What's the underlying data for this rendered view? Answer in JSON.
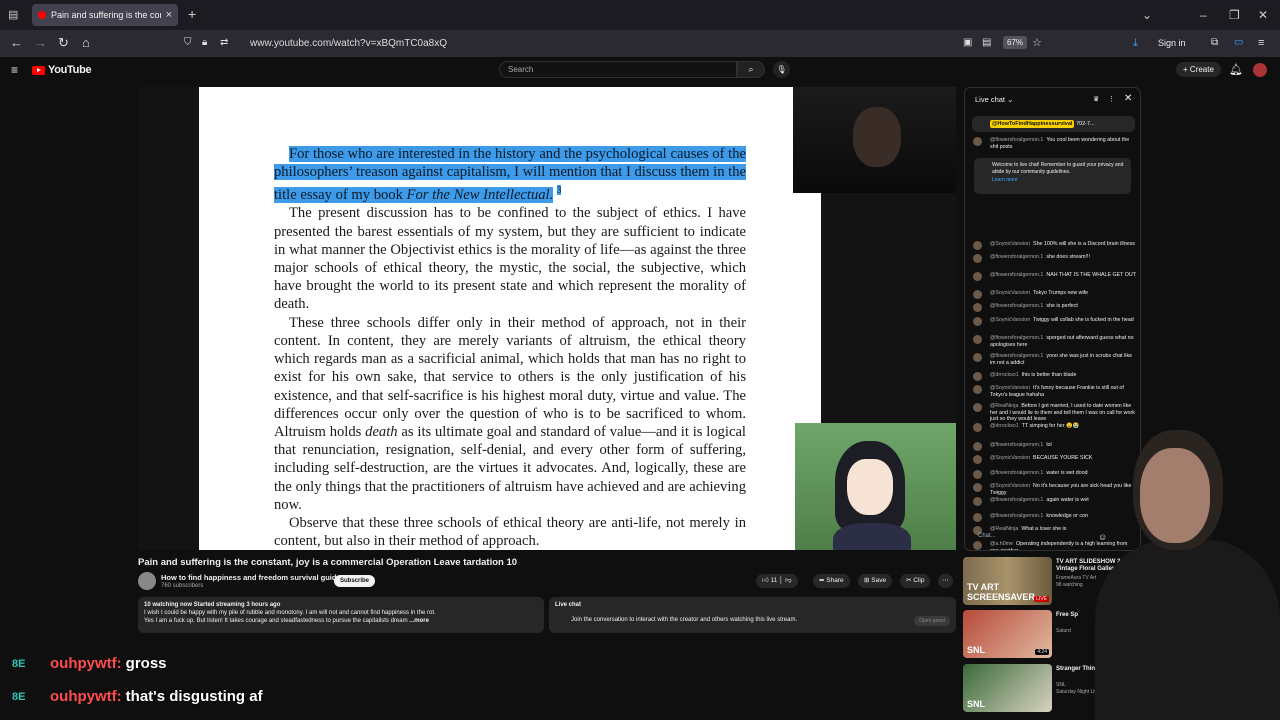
{
  "browser": {
    "tab_title": "Pain and suffering is the constant",
    "url": "www.youtube.com/watch?v=xBQmTC0a8xQ",
    "zoom": "67%",
    "sign_in": "Sign in"
  },
  "youtube": {
    "logo": "YouTube",
    "search_placeholder": "Search",
    "create_label": "Create"
  },
  "book": {
    "para1_hl_a": "For those who are interested in the history and the psychological causes of the philosophers’ treason against capitalism, I will mention that I discuss them in the title essay of my book ",
    "para1_hl_italic": "For the New Intellectual.",
    "para1_sup": "3",
    "para2": "The present discussion has to be confined to the subject of ethics. I have presented the barest essentials of my system, but they are sufficient to indicate in what manner the Objectivist ethics is the morality of life—as against the three major schools of ethical theory, the mystic, the social, the subjective, which have brought the world to its present state and which represent the morality of death.",
    "para3_a": "These three schools differ only in their method of approach, not in their content. In content, they are merely variants of altruism, the ethical theory which regards man as a sacrificial animal, which holds that man has no right to exist for his own sake, that service to others is the only justification of his existence, and that self-sacrifice is his highest moral duty, virtue and value. The differences occur only over the question of who is to be sacrificed to whom. Altruism holds ",
    "para3_italic": "death",
    "para3_b": " as its ultimate goal and standard of value—and it is logical that renunciation, resignation, self-denial, and every other form of suffering, including self-destruction, are the virtues it advocates. And, logically, these are the only things that the practitioners of altruism have achieved and are achieving now.",
    "para4": "Observe that these three schools of ethical theory are anti-life, not merely in content, but also in their method of approach."
  },
  "video": {
    "title": "Pain and suffering is the constant, joy is a commercial Operation Leave tardation 10",
    "channel": "How to find happiness and freedom survival guide",
    "subscribers": "760 subscribers",
    "subscribe": "Subscribe",
    "likes": "11",
    "share": "Share",
    "save": "Save",
    "clip": "Clip",
    "desc_meta": "10 watching now  Started streaming 3 hours ago",
    "desc_line1": "I wish I could be happy with my pile of rubble and monotony. I am will not and cannot find happiness in the rot.",
    "desc_line2": "Yes I am a fuck up. But listen! It takes courage and steadfastedness to pursue the capitalists dream",
    "desc_more": "...more",
    "livechat_label": "Live chat",
    "livechat_text": "Join the conversation to interact with the creator and others watching this live stream.",
    "open_panel": "Open panel"
  },
  "chat": {
    "header": "Live chat",
    "pinned_user": "@HowToFindHappinessurvival",
    "pinned_text": "702-7...",
    "welcome": "Welcome to live chat! Remember to guard your privacy and abide by our community guidelines.",
    "learn_more": "Learn more",
    "input_placeholder": "Chat...",
    "first_msg": {
      "author": "@flowersforalgernon.1",
      "text": "You cool been wondering about the shit posts"
    },
    "messages": [
      {
        "author": "@SoynicVansion",
        "text": "She 100% will she is a Discord brain illness"
      },
      {
        "author": "@flowersforalgernon.1",
        "text": "she does stream!!!"
      },
      {
        "author": "@flowersforalgernon.1",
        "text": "NAH THAT IS THE WHALE GET OUT"
      },
      {
        "author": "@SoynicVansion",
        "text": "Tokyo Trumps new wife"
      },
      {
        "author": "@flowersforalgernon.1",
        "text": "she is perfect"
      },
      {
        "author": "@SoynicVansion",
        "text": "Twiggy will collab she is fucked in the head"
      },
      {
        "author": "@flowersforalgernon.1",
        "text": "sperged out afterward guess what no apologises here"
      },
      {
        "author": "@flowersforalgernon.1",
        "text": "yooo she was just in scrubs chat like im not a addict"
      },
      {
        "author": "@drrockso1",
        "text": "this is better than blade"
      },
      {
        "author": "@SoynicVansion",
        "text": "It's funny because Frankie is still out of Tokyo's league hahaha"
      },
      {
        "author": "@RealNinja",
        "text": "Before I got married, I used to date women like her and I would lie to them and tell them I was on call for work just so they would leave"
      },
      {
        "author": "@drrockso1",
        "text": "TT simping for her 😧😭"
      },
      {
        "author": "@flowersforalgernon.1",
        "text": "lol"
      },
      {
        "author": "@SoynicVansion",
        "text": "BECAUSE YOURE SICK"
      },
      {
        "author": "@flowersforalgernon.1",
        "text": "water is wet dood"
      },
      {
        "author": "@SoynicVansion",
        "text": "No it's because you are sick head you like Twiggy"
      },
      {
        "author": "@flowersforalgernon.1",
        "text": "again water is wet"
      },
      {
        "author": "@flowersforalgernon.1",
        "text": "knowledge or con"
      },
      {
        "author": "@RealNinja",
        "text": "What a loser she is"
      },
      {
        "author": "@a.h0me",
        "text": "Operating independently is a high learning from one another."
      }
    ]
  },
  "related": [
    {
      "title": "TV ART SLIDESHOW 24/7 Vintage Floral Gallery",
      "channel": "FrameAura TV Art",
      "meta": "98 watching",
      "badge": "LIVE",
      "thumb_label": "TV ART SCREENSAVER"
    },
    {
      "title": "Free Sp",
      "channel": "Saturd",
      "meta": "",
      "badge": "4:24",
      "thumb_label": "SNL"
    },
    {
      "title": "Stranger Things Promo",
      "channel": "SNL",
      "meta": "Saturday Night Live",
      "badge": "",
      "thumb_label": "SNL"
    }
  ],
  "overlay_chat": [
    {
      "badge": "8E",
      "user": "ouhpywtf:",
      "text": "gross"
    },
    {
      "badge": "8E",
      "user": "ouhpywtf:",
      "text": "that's disgusting af"
    }
  ],
  "colors": {
    "highlight": "#3d9be9",
    "yt_red": "#ff0000",
    "overlay_user": "#ff4d4d",
    "overlay_badge": "#2ec4b6"
  }
}
